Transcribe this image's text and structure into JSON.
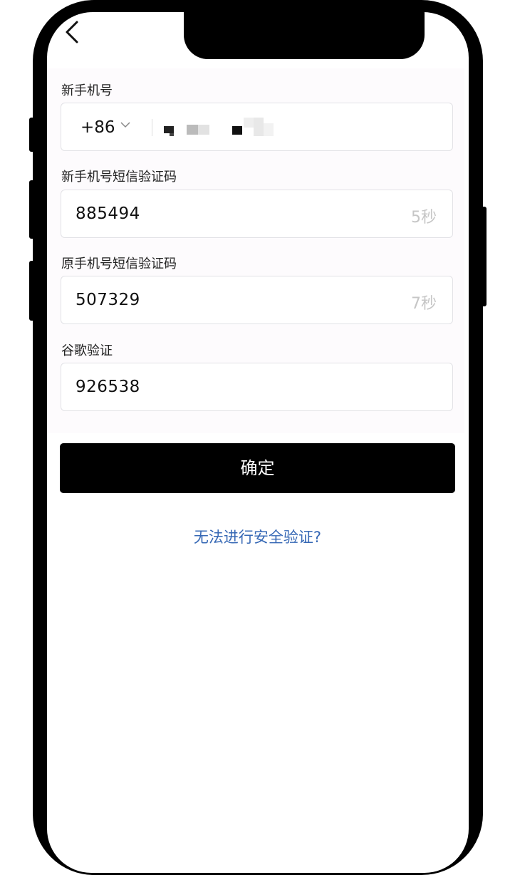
{
  "header": {
    "back_icon": "chevron-left-icon"
  },
  "form": {
    "new_phone": {
      "label": "新手机号",
      "country_code": "+86",
      "country_code_icon": "chevron-down-icon"
    },
    "new_sms": {
      "label": "新手机号短信验证码",
      "value": "885494",
      "timer": "5秒"
    },
    "old_sms": {
      "label": "原手机号短信验证码",
      "value": "507329",
      "timer": "7秒"
    },
    "google": {
      "label": "谷歌验证",
      "value": "926538"
    }
  },
  "actions": {
    "confirm_label": "确定",
    "help_link": "无法进行安全验证?"
  }
}
